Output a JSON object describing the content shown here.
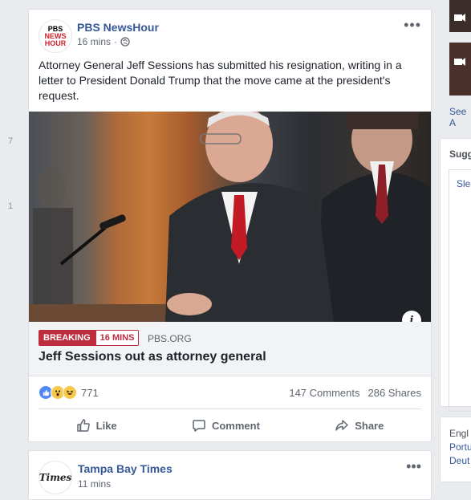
{
  "left_numbers": [
    "7",
    "1"
  ],
  "post1": {
    "page_name": "PBS NewsHour",
    "avatar_lines": [
      "PBS",
      "NEWS",
      "HOUR"
    ],
    "time": "16 mins",
    "privacy_icon": "globe-icon",
    "text": "Attorney General Jeff Sessions has submitted his resignation, writing in a letter to President Donald Trump that the move came at the president's request.",
    "link": {
      "badge": "BREAKING",
      "badge_time": "16 MINS",
      "domain": "PBS.ORG",
      "headline": "Jeff Sessions out as attorney general"
    },
    "reactions": {
      "count": "771",
      "icons": [
        "like-icon",
        "wow-icon",
        "haha-icon"
      ]
    },
    "comments": "147 Comments",
    "shares": "286 Shares",
    "actions": {
      "like": "Like",
      "comment": "Comment",
      "share": "Share"
    }
  },
  "post2": {
    "page_name": "Tampa Bay Times",
    "avatar_text": "Times",
    "time": "11 mins"
  },
  "right": {
    "see_all": "See A",
    "suggest_title": "Sugg",
    "suggest_link": "Sle",
    "languages": [
      "Engl",
      "Portu",
      "Deut"
    ]
  },
  "colors": {
    "link_blue": "#365899",
    "breaking_red": "#bd2d3d",
    "bg": "#e9ebee"
  }
}
